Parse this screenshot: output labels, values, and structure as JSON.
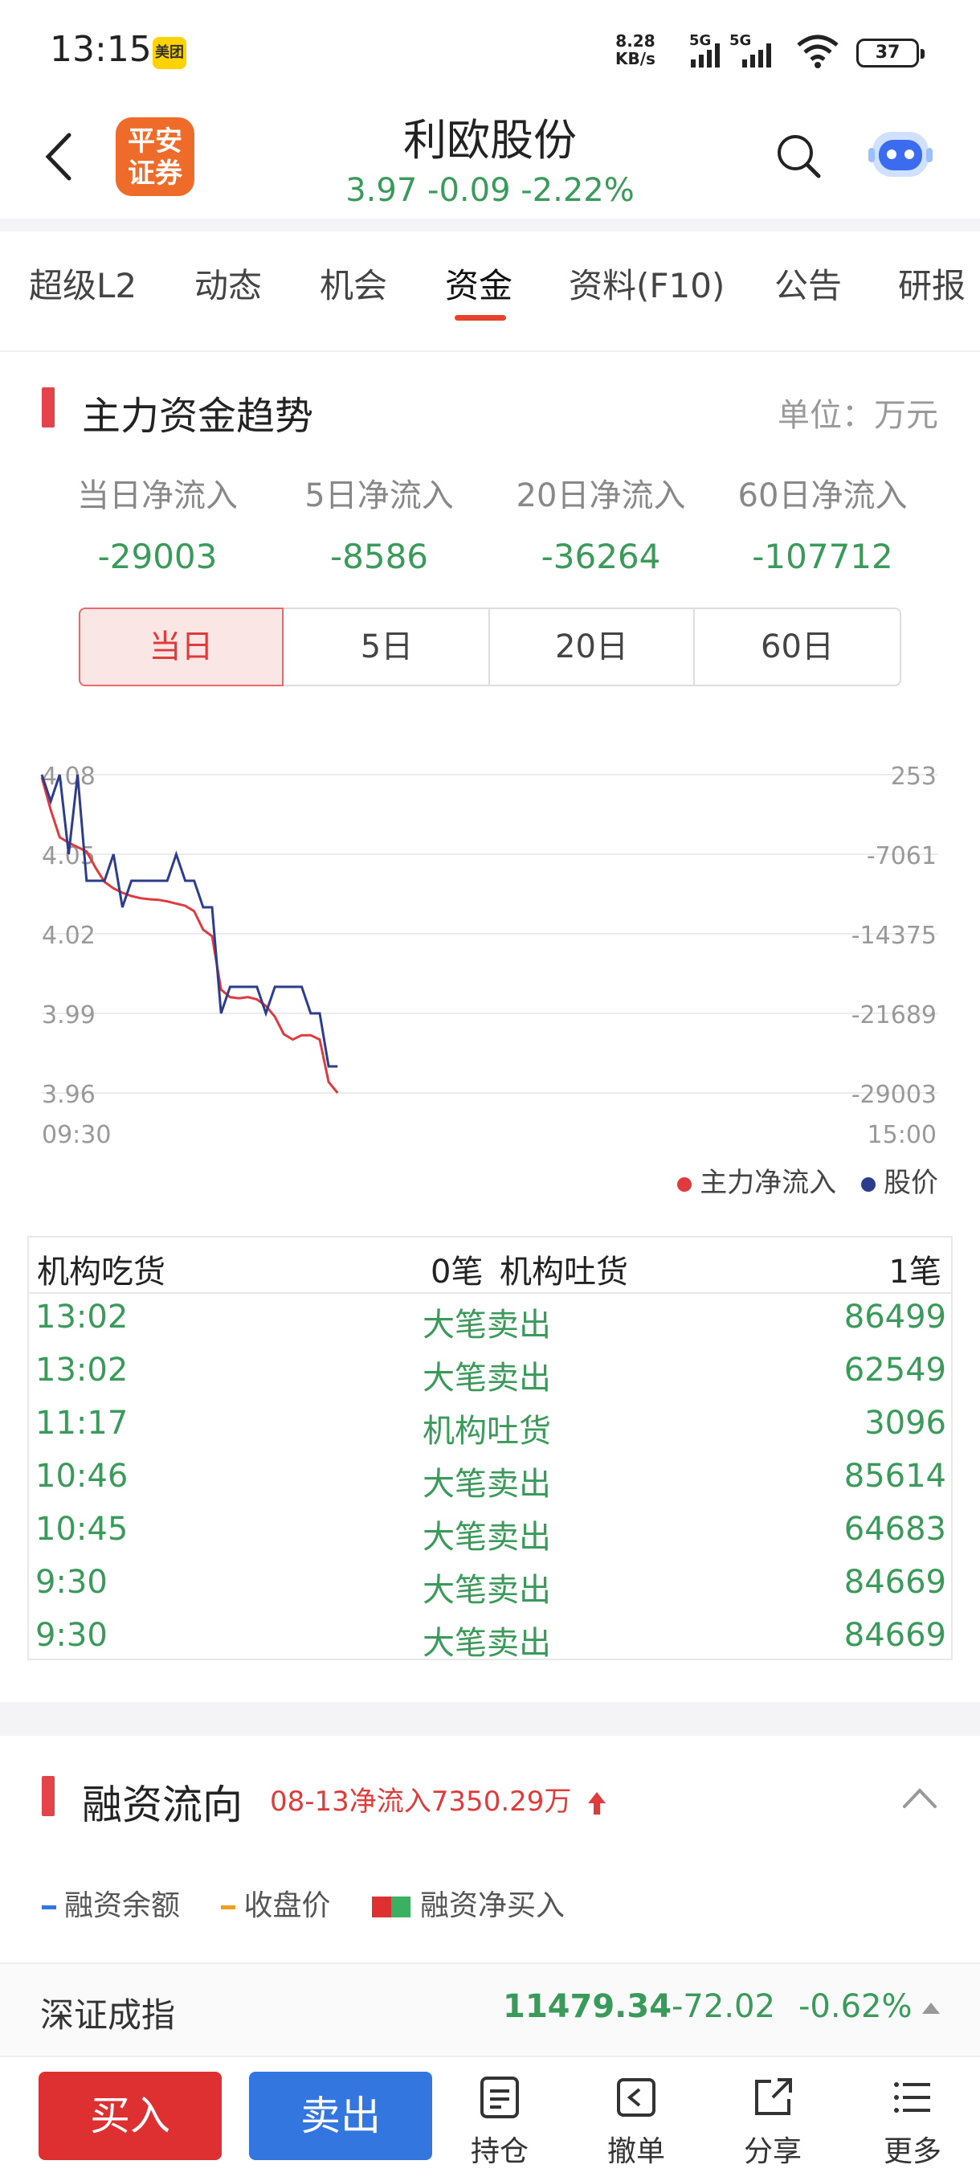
{
  "status_bar": {
    "time": "13:15",
    "badge": "美团",
    "net_speed_value": "8.28",
    "net_speed_unit": "KB/s",
    "signal_1": "5G",
    "signal_2": "5G",
    "battery": "37"
  },
  "header": {
    "logo_line1": "平安",
    "logo_line2": "证券",
    "stock_name": "利欧股份",
    "price": "3.97",
    "change": "-0.09",
    "change_pct": "-2.22%"
  },
  "tabs": [
    {
      "label": "超级L2",
      "active": false
    },
    {
      "label": "动态",
      "active": false
    },
    {
      "label": "机会",
      "active": false
    },
    {
      "label": "资金",
      "active": true
    },
    {
      "label": "资料(F10)",
      "active": false
    },
    {
      "label": "公告",
      "active": false
    },
    {
      "label": "研报",
      "active": false
    }
  ],
  "main_section": {
    "title": "主力资金趋势",
    "unit": "单位：万元",
    "stats": [
      {
        "label": "当日净流入",
        "value": "-29003"
      },
      {
        "label": "5日净流入",
        "value": "-8586"
      },
      {
        "label": "20日净流入",
        "value": "-36264"
      },
      {
        "label": "60日净流入",
        "value": "-107712"
      }
    ],
    "periods": [
      "当日",
      "5日",
      "20日",
      "60日"
    ],
    "active_period": "当日"
  },
  "chart_data": {
    "type": "line",
    "x_start": "09:30",
    "x_end": "15:00",
    "left_axis_ticks": [
      "4.08",
      "4.05",
      "4.02",
      "3.99",
      "3.96"
    ],
    "right_axis_ticks": [
      "253",
      "-7061",
      "-14375",
      "-21689",
      "-29003"
    ],
    "left_ylim": [
      3.96,
      4.08
    ],
    "right_ylim": [
      -29003,
      253
    ],
    "grid": true,
    "legend_position": "bottom-right",
    "series": [
      {
        "name": "主力净流入",
        "axis": "right",
        "color": "#e0393e",
        "values": [
          0,
          -3000,
          -5500,
          -6000,
          -6400,
          -6800,
          -8300,
          -9600,
          -10200,
          -10600,
          -10900,
          -11100,
          -11200,
          -11250,
          -11400,
          -11600,
          -11800,
          -12300,
          -14000,
          -14600,
          -19500,
          -20200,
          -20300,
          -20200,
          -20400,
          -21000,
          -22000,
          -23600,
          -24100,
          -23700,
          -23700,
          -24100,
          -28000,
          -29000
        ]
      },
      {
        "name": "股价",
        "axis": "left",
        "color": "#2d3c8c",
        "values": [
          4.08,
          4.07,
          4.08,
          4.05,
          4.08,
          4.04,
          4.04,
          4.04,
          4.05,
          4.03,
          4.04,
          4.04,
          4.04,
          4.04,
          4.04,
          4.05,
          4.04,
          4.04,
          4.03,
          4.03,
          3.99,
          4.0,
          4.0,
          4.0,
          4.0,
          3.99,
          4.0,
          4.0,
          4.0,
          4.0,
          3.99,
          3.99,
          3.97,
          3.97
        ]
      }
    ]
  },
  "trade_table": {
    "header_left_label": "机构吃货",
    "header_left_count": "0笔",
    "header_right_label": "机构吐货",
    "header_right_count": "1笔",
    "rows": [
      {
        "time": "13:02",
        "type": "大笔卖出",
        "volume": "86499"
      },
      {
        "time": "13:02",
        "type": "大笔卖出",
        "volume": "62549"
      },
      {
        "time": "11:17",
        "type": "机构吐货",
        "volume": "3096"
      },
      {
        "time": "10:46",
        "type": "大笔卖出",
        "volume": "85614"
      },
      {
        "time": "10:45",
        "type": "大笔卖出",
        "volume": "64683"
      },
      {
        "time": "9:30",
        "type": "大笔卖出",
        "volume": "84669"
      },
      {
        "time": "9:30",
        "type": "大笔卖出",
        "volume": "84669"
      }
    ]
  },
  "margin_section": {
    "title": "融资流向",
    "note": "08-13净流入7350.29万",
    "legend": [
      {
        "label": "融资余额",
        "color": "#3476e0"
      },
      {
        "label": "收盘价",
        "color": "#f0a020"
      },
      {
        "label": "融资净买入",
        "color": "#de3030"
      }
    ]
  },
  "index_bar": {
    "name": "深证成指",
    "value": "11479.34",
    "change": "-72.02",
    "change_pct": "-0.62%"
  },
  "toolbar": {
    "buy_label": "买入",
    "sell_label": "卖出",
    "items": [
      {
        "label": "持仓",
        "icon": "document-icon"
      },
      {
        "label": "撤单",
        "icon": "undo-icon"
      },
      {
        "label": "分享",
        "icon": "share-icon"
      },
      {
        "label": "更多",
        "icon": "menu-icon"
      }
    ]
  }
}
